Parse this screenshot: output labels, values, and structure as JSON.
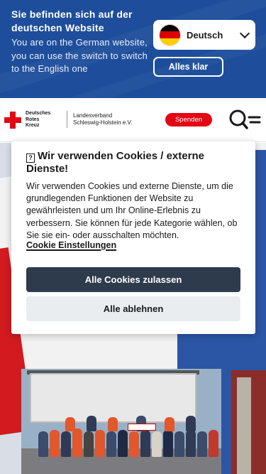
{
  "language_banner": {
    "title": "Sie befinden sich auf der deutschen Website",
    "description": "You are on the German website, you can use the switch to switch to the English one",
    "selected_language": "Deutsch",
    "confirm_label": "Alles klar",
    "flag_icon": "germany-flag-icon",
    "background_color": "#1e4e9b"
  },
  "header": {
    "logo_lines": [
      "Deutsches",
      "Rotes",
      "Kreuz"
    ],
    "org_lines": [
      "Landesverband",
      "Schleswig-Holstein e.V."
    ],
    "donate_label": "Spenden",
    "menu_icon": "search-menu-icon",
    "accent_color": "#e30613"
  },
  "cookie_dialog": {
    "title_icon": "question-icon",
    "title": "Wir verwenden Cookies / externe Dienste!",
    "body": "Wir verwenden Cookies und externe Dienste, um die grundlegenden Funktionen der Website zu gewährleisten und um Ihr Online-Erlebnis zu verbessern. Sie können für jede Kategorie wählen, ob Sie sie ein- oder ausschalten möchten.",
    "settings_link": "Cookie Einstellungen",
    "accept_all_label": "Alle Cookies zulassen",
    "reject_all_label": "Alle ablehnen",
    "primary_color": "#2d3b4d"
  }
}
